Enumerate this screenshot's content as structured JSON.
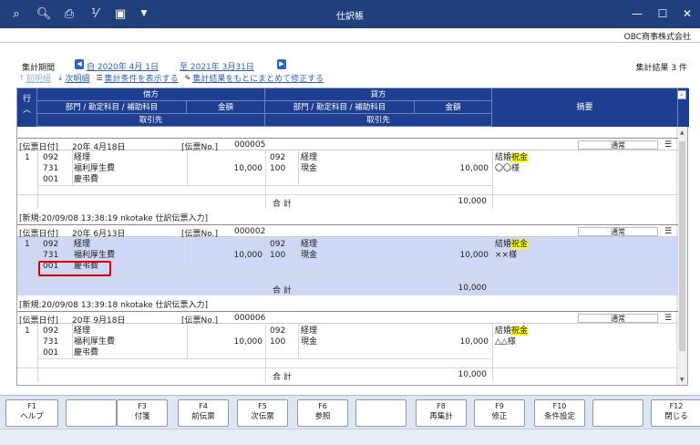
{
  "window": {
    "title": "仕訳帳",
    "minimize": "—",
    "maximize": "☐",
    "close": "✕"
  },
  "toolbar": [
    "search-plus-icon",
    "search-page-icon",
    "print-icon",
    "calculator-icon",
    "excel-icon",
    "dropdown-icon"
  ],
  "company": "OBC商事株式会社",
  "period": {
    "label": "集計期間",
    "from": "自 2020年  4月 1日",
    "to": "至 2021年  3月31日"
  },
  "result_count": "集計結果 3 件",
  "links": {
    "prev": "前明細",
    "next": "次明細",
    "show_conditions": "集計条件を表示する",
    "bulk_edit": "集計結果をもとにまとめて修正する"
  },
  "header": {
    "line": "行",
    "debit": "借方",
    "credit": "貸方",
    "dept_account": "部門 / 勘定科目 / 補助科目",
    "amount": "金額",
    "partner": "取引先",
    "memo": "摘要"
  },
  "vouchers": [
    {
      "date_label": "[伝票日付]",
      "date": "20年  4月18日",
      "no_label": "[伝票No.]",
      "no": "000005",
      "type": "通常",
      "row": "1",
      "d_dept": "092",
      "d_dept_name": "経理",
      "d_acct": "731",
      "d_acct_name": "福利厚生費",
      "d_sub": "001",
      "d_sub_name": "慶弔費",
      "d_amount": "10,000",
      "c_dept": "092",
      "c_dept_name": "経理",
      "c_acct": "100",
      "c_acct_name": "現金",
      "c_amount": "10,000",
      "memo_prefix": "結婚",
      "memo_hl": "祝金",
      "memo_line2": "〇〇様",
      "total_label": "合 計",
      "total": "10,000",
      "audit": "[新規:20/09/08 13:38:19  nkotake  仕訳伝票入力]"
    },
    {
      "date_label": "[伝票日付]",
      "date": "20年  6月13日",
      "no_label": "[伝票No.]",
      "no": "000002",
      "type": "通常",
      "row": "1",
      "d_dept": "092",
      "d_dept_name": "経理",
      "d_acct": "731",
      "d_acct_name": "福利厚生費",
      "d_sub": "001",
      "d_sub_name": "慶弔費",
      "d_amount": "10,000",
      "c_dept": "092",
      "c_dept_name": "経理",
      "c_acct": "100",
      "c_acct_name": "現金",
      "c_amount": "10,000",
      "memo_prefix": "結婚",
      "memo_hl": "祝金",
      "memo_line2": "××様",
      "total_label": "合 計",
      "total": "10,000",
      "audit": "[新規:20/09/08 13:39:18  nkotake  仕訳伝票入力]"
    },
    {
      "date_label": "[伝票日付]",
      "date": "20年  9月18日",
      "no_label": "[伝票No.]",
      "no": "000006",
      "type": "通常",
      "row": "1",
      "d_dept": "092",
      "d_dept_name": "経理",
      "d_acct": "731",
      "d_acct_name": "福利厚生費",
      "d_sub": "001",
      "d_sub_name": "慶弔費",
      "d_amount": "10,000",
      "c_dept": "092",
      "c_dept_name": "経理",
      "c_acct": "100",
      "c_acct_name": "現金",
      "c_amount": "10,000",
      "memo_prefix": "結婚",
      "memo_hl": "祝金",
      "memo_line2": "△△様",
      "total_label": "合 計",
      "total": "10,000",
      "audit": ""
    }
  ],
  "fkeys": [
    {
      "key": "F1",
      "label": "ヘルプ"
    },
    {
      "key": "",
      "label": ""
    },
    {
      "key": "F3",
      "label": "付箋"
    },
    {
      "key": "F4",
      "label": "前伝票"
    },
    {
      "key": "F5",
      "label": "次伝票"
    },
    {
      "key": "F6",
      "label": "参照"
    },
    {
      "key": "",
      "label": ""
    },
    {
      "key": "F8",
      "label": "再集計"
    },
    {
      "key": "F9",
      "label": "修正"
    },
    {
      "key": "F10",
      "label": "条件設定"
    },
    {
      "key": "",
      "label": ""
    },
    {
      "key": "F12",
      "label": "閉じる"
    }
  ]
}
